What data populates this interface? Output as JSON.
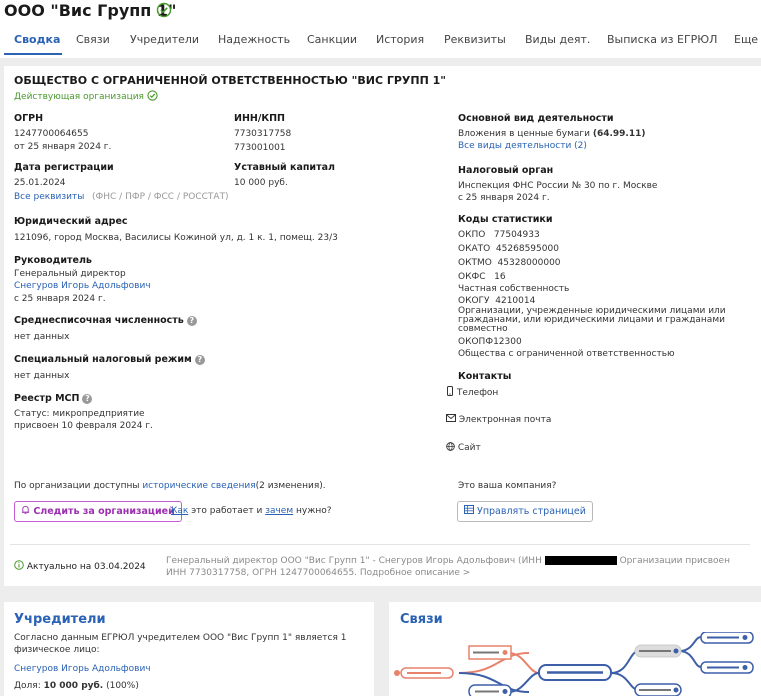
{
  "header": {
    "company_title": "ООО \"Вис Групп 1\"",
    "tabs": [
      "Сводка",
      "Связи",
      "Учредители",
      "Надежность",
      "Санкции",
      "История",
      "Реквизиты",
      "Виды деят.",
      "Выписка из ЕГРЮЛ",
      "Еще"
    ]
  },
  "summary": {
    "full_name": "ОБЩЕСТВО С ОГРАНИЧЕННОЙ ОТВЕТСТВЕННОСТЬЮ \"ВИС ГРУПП 1\"",
    "status": "Действующая организация",
    "ogrn_label": "ОГРН",
    "ogrn_value": "1247700064655",
    "ogrn_date": "от 25 января 2024 г.",
    "inn_label": "ИНН/КПП",
    "inn_value": "7730317758",
    "kpp_value": "773001001",
    "regdate_label": "Дата регистрации",
    "regdate_value": "25.01.2024",
    "capital_label": "Уставный капитал",
    "capital_value": "10 000 руб.",
    "all_requisites_link": "Все реквизиты",
    "requisites_sources": "(ФНС / ПФР / ФСС / РОССТАТ)",
    "address_label": "Юридический адрес",
    "address_value": "121096, город Москва, Василисы Кожиной ул, д. 1 к. 1, помещ. 23/3",
    "head_label": "Руководитель",
    "head_position": "Генеральный директор",
    "head_name": "Снегуров Игорь Адольфович",
    "head_since": "с 25 января 2024 г.",
    "headcount_label": "Среднесписочная численность",
    "headcount_value": "нет данных",
    "tax_regime_label": "Специальный налоговый режим",
    "tax_regime_value": "нет данных",
    "msp_label": "Реестр МСП",
    "msp_status": "Статус: микропредприятие",
    "msp_date": "присвоен 10 февраля 2024 г.",
    "activity_label": "Основной вид деятельности",
    "activity_value": "Вложения в ценные бумаги",
    "activity_code": "(64.99.11)",
    "all_activities_link": "Все виды деятельности (2)",
    "tax_org_label": "Налоговый орган",
    "tax_org_value": "Инспекция ФНС России № 30 по г. Москве",
    "tax_org_since": "с 25 января 2024 г.",
    "stat_codes_label": "Коды статистики",
    "okpo": "ОКПО   77504933",
    "okato": "ОКАТО  45268595000",
    "oktmo": "ОКТМО  45328000000",
    "okfs": "ОКФС   16",
    "okfs_desc": "Частная собственность",
    "okogu": "ОКОГУ  4210014",
    "okogu_desc": "Организации, учрежденные юридическими лицами или гражданами, или юридическими лицами и гражданами совместно",
    "okopf": "ОКОПФ12300",
    "okopf_desc": "Общества с ограниченной ответственностью",
    "contacts_label": "Контакты",
    "phone": "Телефон",
    "email": "Электронная почта",
    "site": "Сайт",
    "history_prefix": "По организации доступны",
    "history_link": "исторические сведения",
    "history_suffix": "(2 изменения).",
    "follow_button": "Следить за организацией",
    "how_link": "Как",
    "how_mid": "это работает и",
    "why_link": "зачем",
    "why_suffix": "нужно?",
    "your_company": "Это ваша компания?",
    "manage_button": "Управлять страницей",
    "actual_date": "Актуально на 03.04.2024",
    "desc_line1_a": "Генеральный директор ООО \"Вис Групп 1\" - Снегуров Игорь Адольфович (ИНН",
    "desc_line1_b": "Организации присвоен",
    "desc_line2": "ИНН 7730317758, ОГРН 1247700064655. Подробное описание >"
  },
  "founders": {
    "title": "Учредители",
    "text": "Согласно данным ЕГРЮЛ учредителем ООО \"Вис Групп 1\" является 1 физическое лицо:",
    "name": "Снегуров Игорь Адольфович",
    "share_label": "Доля:",
    "share_value": "10 000 руб.",
    "share_percent": "(100%)"
  },
  "links": {
    "title": "Связи"
  },
  "colors": {
    "accent": "#2a62b4",
    "status_green": "#4a9a2e",
    "follow_purple": "#9b2fb0",
    "graph_red": "#e8826a",
    "graph_blue": "#3d5fa8"
  }
}
